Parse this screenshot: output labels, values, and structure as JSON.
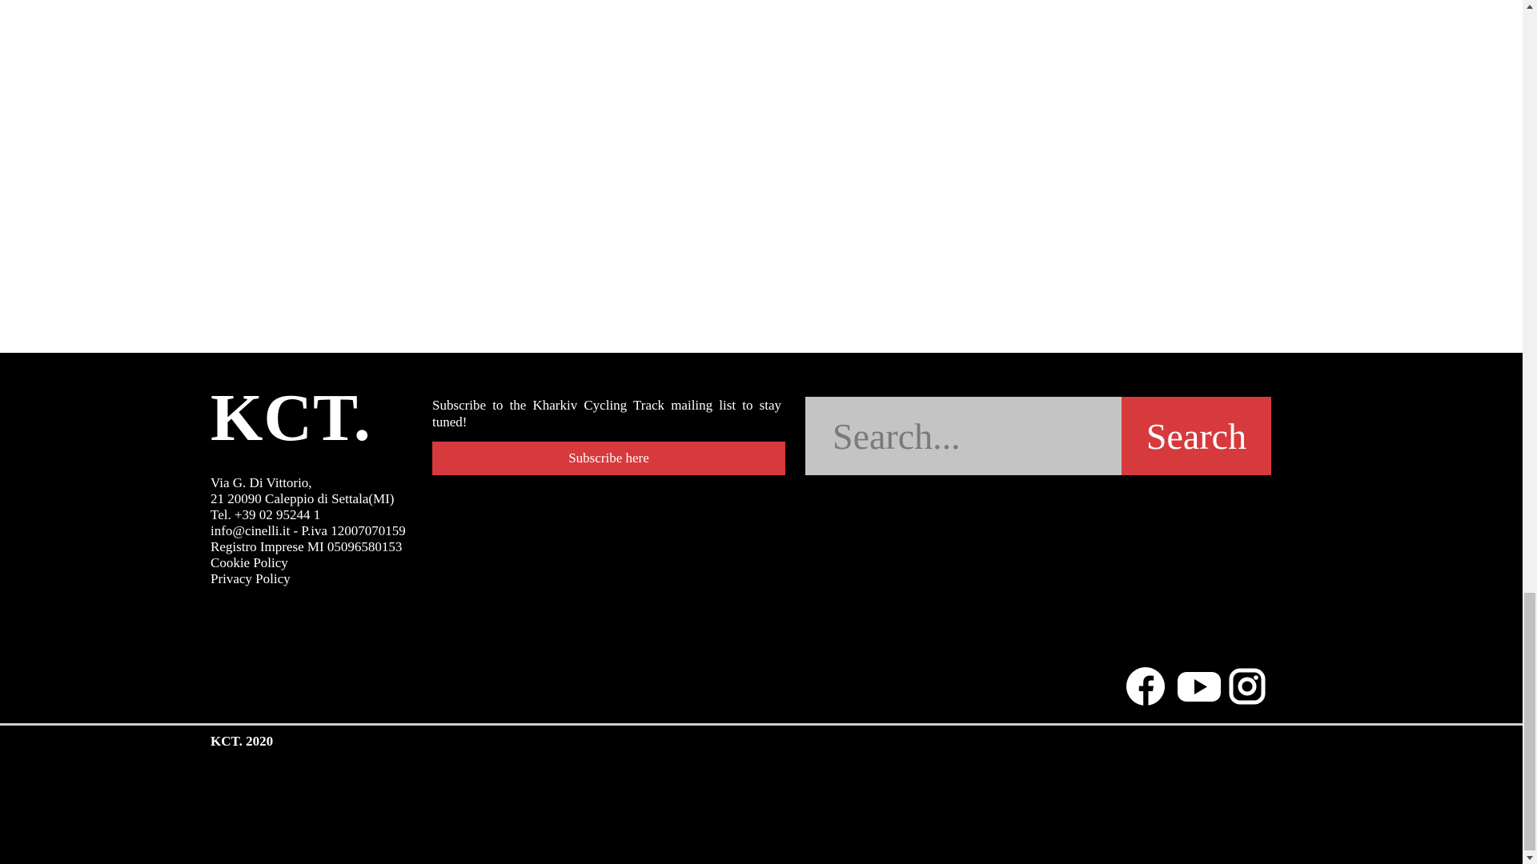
{
  "footer": {
    "logo": "KCT.",
    "address": [
      "Via G. Di Vittorio,",
      "21 20090 Caleppio di Settala(MI)",
      "Tel. +39 02 95244 1",
      "info@cinelli.it - P.iva 12007070159",
      "Registro Imprese MI 05096580153"
    ],
    "links": {
      "cookie": "Cookie Policy",
      "privacy": "Privacy Policy"
    },
    "subscribe": {
      "text": "Subscribe to the Kharkiv Cycling Track mailing list to stay tuned!",
      "button_label": "Subscribe here"
    },
    "search": {
      "placeholder": "Search...",
      "button_label": "Search"
    },
    "social": [
      "facebook-icon",
      "youtube-icon",
      "instagram-icon"
    ],
    "copyright": "KCT. 2020"
  },
  "colors": {
    "footer_bg": "#000000",
    "accent_red": "#d63a3c",
    "search_bg": "#c4c4c4",
    "text": "#ffffff"
  }
}
